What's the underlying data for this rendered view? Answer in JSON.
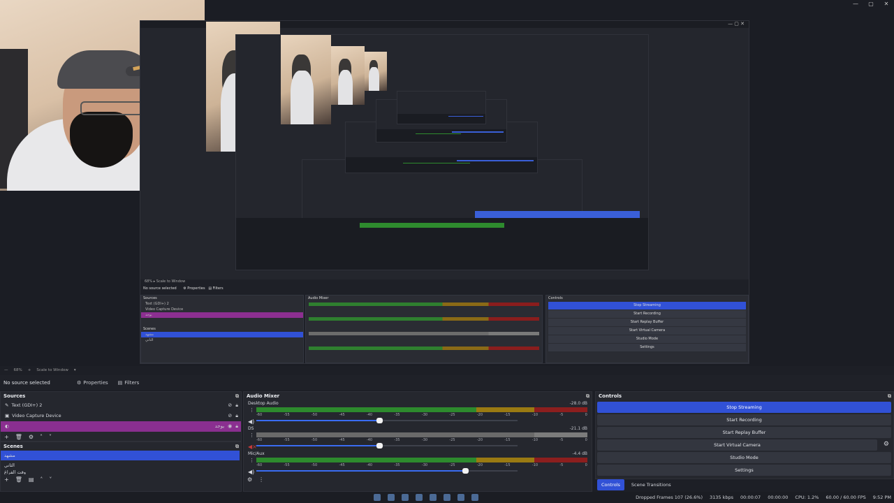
{
  "window": {
    "controls": [
      "—",
      "▢",
      "✕"
    ]
  },
  "zoom": {
    "percent": "68%",
    "mode": "Scale to Window"
  },
  "context": {
    "no_source": "No source selected",
    "properties": "Properties",
    "filters": "Filters"
  },
  "sources": {
    "title": "Sources",
    "items": [
      {
        "label": "Text (GDI+) 2",
        "icon": "text-icon"
      },
      {
        "label": "Video Capture Device",
        "icon": "camera-icon"
      },
      {
        "label": "يوجد",
        "icon": "audio-icon"
      }
    ]
  },
  "scenes": {
    "title": "Scenes",
    "items": [
      "مشهد",
      "الثاني",
      "وقت الفراغ"
    ]
  },
  "mixer": {
    "title": "Audio Mixer",
    "channels": [
      {
        "name": "Desktop Audio",
        "db": "-28.0 dB",
        "level": 0.47,
        "muted": false,
        "meter": "color"
      },
      {
        "name": "DS",
        "db": "-21.1 dB",
        "level": 0.47,
        "muted": true,
        "meter": "gray"
      },
      {
        "name": "Mic/Aux",
        "db": "-4.4 dB",
        "level": 0.8,
        "muted": false,
        "meter": "color"
      }
    ],
    "ticks": [
      "-60",
      "-55",
      "-50",
      "-45",
      "-40",
      "-35",
      "-30",
      "-25",
      "-20",
      "-15",
      "-10",
      "-5",
      "0"
    ]
  },
  "controls": {
    "title": "Controls",
    "buttons": [
      "Stop Streaming",
      "Start Recording",
      "Start Replay Buffer",
      "Start Virtual Camera",
      "Studio Mode",
      "Settings"
    ],
    "tabs": [
      "Controls",
      "Scene Transitions"
    ]
  },
  "status": {
    "dropped": "Dropped Frames 107 (26.6%)",
    "bitrate": "3135 kbps",
    "stream_time": "00:00:07",
    "rec_time": "00:00:00",
    "cpu": "CPU: 1.2%",
    "fps": "60.00 / 60.00 FPS",
    "clock": "9:52 PM"
  },
  "colors": {
    "accent": "#3151d6",
    "selected_source": "#8a2f90"
  }
}
